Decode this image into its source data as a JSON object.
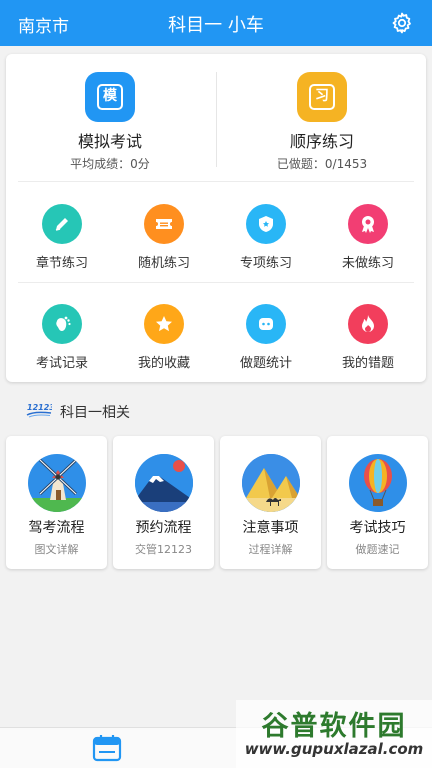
{
  "header": {
    "city": "南京市",
    "title": "科目一 小车"
  },
  "main_modes": [
    {
      "label": "模拟考试",
      "sub": "平均成绩：0分",
      "glyph": "模",
      "color": "#2196f3"
    },
    {
      "label": "顺序练习",
      "sub": "已做题：0/1453",
      "glyph": "习",
      "color": "#f5b323"
    }
  ],
  "practice_row": [
    {
      "label": "章节练习",
      "color": "#26c6b6",
      "icon": "pencil-icon"
    },
    {
      "label": "随机练习",
      "color": "#ff8f1f",
      "icon": "ticket-icon"
    },
    {
      "label": "专项练习",
      "color": "#29b6f6",
      "icon": "shield-icon"
    },
    {
      "label": "未做练习",
      "color": "#f23e73",
      "icon": "badge-icon"
    }
  ],
  "record_row": [
    {
      "label": "考试记录",
      "color": "#26c6b6",
      "icon": "footprint-icon"
    },
    {
      "label": "我的收藏",
      "color": "#ffa718",
      "icon": "star-icon"
    },
    {
      "label": "做题统计",
      "color": "#29b6f6",
      "icon": "chat-icon"
    },
    {
      "label": "我的错题",
      "color": "#f23e5c",
      "icon": "flame-icon"
    }
  ],
  "section": {
    "logo_text": "12123",
    "title": "科目一相关"
  },
  "guides": [
    {
      "label": "驾考流程",
      "sub": "图文详解",
      "icon": "windmill-icon"
    },
    {
      "label": "预约流程",
      "sub": "交管12123",
      "icon": "mount-fuji-icon"
    },
    {
      "label": "注意事项",
      "sub": "过程详解",
      "icon": "pyramids-icon"
    },
    {
      "label": "考试技巧",
      "sub": "做题速记",
      "icon": "hot-air-balloon-icon"
    }
  ],
  "bottom_nav": {
    "icon": "calendar-icon"
  },
  "watermark": {
    "title": "谷普软件园",
    "url": "www.gupuxlazal.com"
  }
}
